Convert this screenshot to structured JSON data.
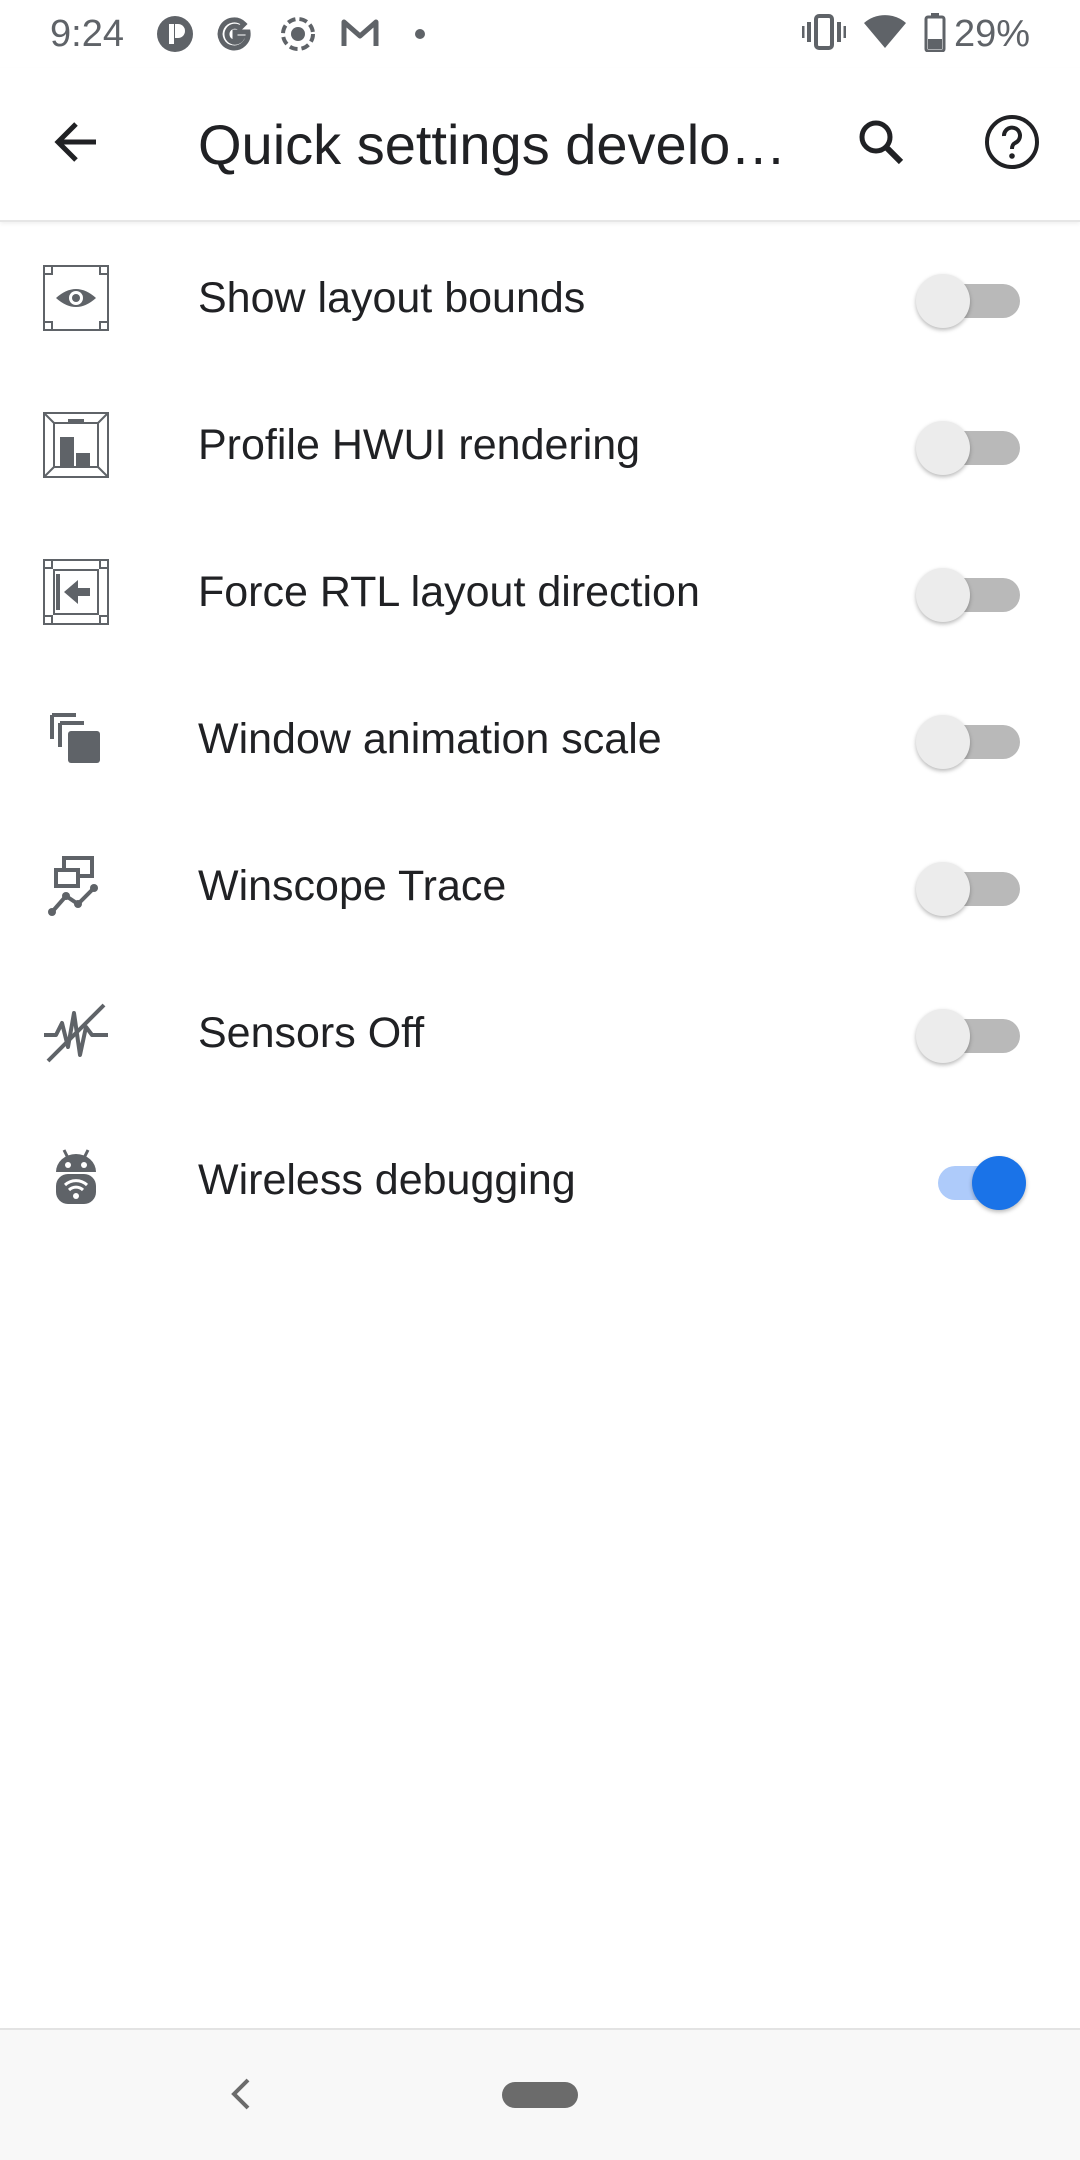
{
  "status_bar": {
    "time": "9:24",
    "battery_percent": "29%",
    "notification_icons": [
      "app-icon",
      "google-icon",
      "screen-record-icon",
      "gmail-icon",
      "more-dot-icon"
    ],
    "system_icons": [
      "vibrate-icon",
      "wifi-icon",
      "battery-icon"
    ]
  },
  "app_bar": {
    "title": "Quick settings develo…",
    "back_icon": "arrow-back-icon",
    "search_icon": "search-icon",
    "help_icon": "help-icon"
  },
  "tiles": [
    {
      "label": "Show layout bounds",
      "icon": "layout-bounds-icon",
      "enabled": false
    },
    {
      "label": "Profile HWUI rendering",
      "icon": "hwui-profile-icon",
      "enabled": false
    },
    {
      "label": "Force RTL layout direction",
      "icon": "rtl-direction-icon",
      "enabled": false
    },
    {
      "label": "Window animation scale",
      "icon": "window-animation-icon",
      "enabled": false
    },
    {
      "label": "Winscope Trace",
      "icon": "winscope-trace-icon",
      "enabled": false
    },
    {
      "label": "Sensors Off",
      "icon": "sensors-off-icon",
      "enabled": false
    },
    {
      "label": "Wireless debugging",
      "icon": "wireless-debugging-icon",
      "enabled": true
    }
  ],
  "colors": {
    "accent": "#1a73e8",
    "accent_track": "#aecbfa",
    "icon_gray": "#5f6368",
    "text": "#202124"
  },
  "nav_bar": {
    "back_icon": "nav-back-icon",
    "home_icon": "nav-home-pill"
  }
}
